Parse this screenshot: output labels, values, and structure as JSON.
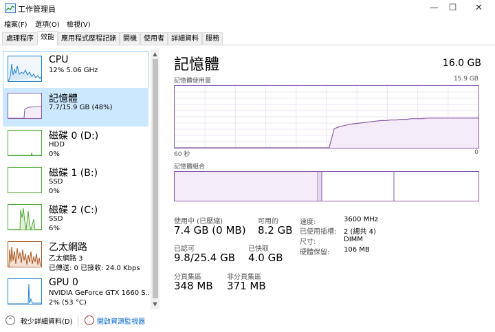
{
  "window": {
    "title": "工作管理員",
    "minimize": "—",
    "maximize": "☐",
    "close": "✕"
  },
  "menu": [
    "檔案(F)",
    "選項(O)",
    "檢視(V)"
  ],
  "tabs": [
    "處理程序",
    "效能",
    "應用程式歷程記錄",
    "開機",
    "使用者",
    "詳細資料",
    "服務"
  ],
  "active_tab": "效能",
  "resources": [
    {
      "name": "CPU",
      "lines": [
        "12%  5.06 GHz"
      ],
      "color": "#1e7fcc"
    },
    {
      "name": "記憶體",
      "lines": [
        "7.7/15.9 GB (48%)"
      ],
      "color": "#8b58a8"
    },
    {
      "name": "磁碟 0 (D:)",
      "lines": [
        "HDD",
        "0%"
      ],
      "color": "#4da832"
    },
    {
      "name": "磁碟 1 (B:)",
      "lines": [
        "SSD",
        "0%"
      ],
      "color": "#4da832"
    },
    {
      "name": "磁碟 2 (C:)",
      "lines": [
        "SSD",
        "6%"
      ],
      "color": "#4da832"
    },
    {
      "name": "乙太網路",
      "lines": [
        "乙太網路 3",
        "已傳送: 0  已接收: 24.0 Kbps"
      ],
      "color": "#a7541e"
    },
    {
      "name": "GPU 0",
      "lines": [
        "NVIDIA GeForce GTX 1660 S...",
        "2% (53 °C)"
      ],
      "color": "#1e7fcc"
    }
  ],
  "memory": {
    "title": "記憶體",
    "total": "16.0 GB",
    "usage_label": "記憶體使用量",
    "usage_max": "15.9 GB",
    "time_left": "60 秒",
    "time_right": "0",
    "composition_label": "記憶體組合",
    "usage_series": [
      0,
      0,
      0,
      0,
      0,
      0,
      0,
      0,
      0,
      0,
      0,
      0,
      0,
      0,
      0,
      0,
      0,
      0,
      0,
      0,
      0,
      0,
      0,
      0,
      0,
      0,
      0,
      0,
      0,
      0,
      0,
      0.31,
      0.34,
      0.36,
      0.38,
      0.39,
      0.4,
      0.41,
      0.42,
      0.43,
      0.44,
      0.44,
      0.45,
      0.45,
      0.46,
      0.46,
      0.47,
      0.47,
      0.47,
      0.48,
      0.48,
      0.48,
      0.48,
      0.48,
      0.48,
      0.48,
      0.48,
      0.48,
      0.48,
      0.48
    ],
    "stats": [
      {
        "label": "使用中 (已壓縮)",
        "value": "7.4 GB (0 MB)"
      },
      {
        "label": "可用的",
        "value": "8.2 GB"
      },
      {
        "label": "已認可",
        "value": "9.8/25.4 GB"
      },
      {
        "label": "已快取",
        "value": "4.0 GB"
      },
      {
        "label": "分頁集區",
        "value": "348 MB"
      },
      {
        "label": "非分頁集區",
        "value": "371 MB"
      }
    ],
    "details": [
      {
        "key": "速度:",
        "value": "3600 MHz"
      },
      {
        "key": "已使用插槽:",
        "value": "2 (總共 4)"
      },
      {
        "key": "尺寸:",
        "value": "DIMM"
      },
      {
        "key": "硬體保留:",
        "value": "106 MB"
      }
    ]
  },
  "footer": {
    "fewer_details": "較少詳細資料(D)",
    "open_monitor": "開啟資源監視器"
  }
}
